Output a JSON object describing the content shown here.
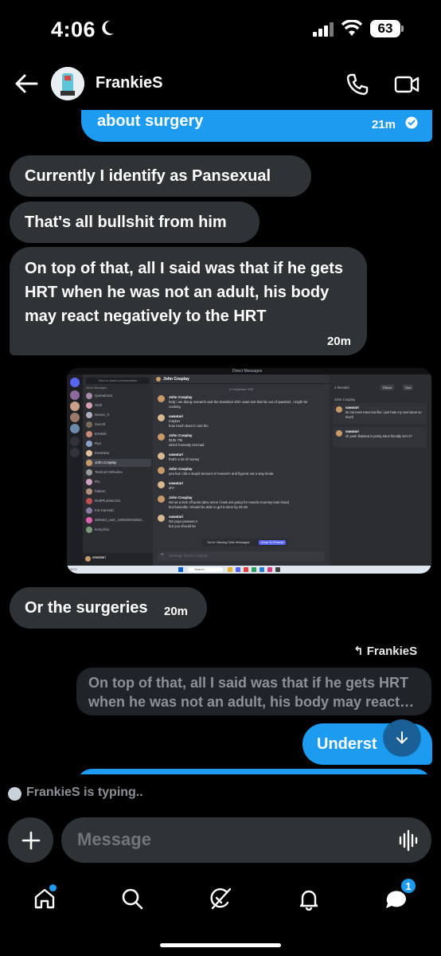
{
  "status_bar": {
    "time": "4:06",
    "battery": "63"
  },
  "header": {
    "contact_name": "FrankieS"
  },
  "messages": [
    {
      "dir": "out",
      "text": "about surgery",
      "time": "21m"
    },
    {
      "dir": "in",
      "text": "Currently I identify as Pansexual"
    },
    {
      "dir": "in",
      "text": "That's all bullshit from him"
    },
    {
      "dir": "in",
      "text": "On top of that, all I said was that if he gets HRT when he was not an adult, his body may react negatively to the HRT",
      "time": "20m"
    },
    {
      "dir": "in",
      "text": "Or the surgeries",
      "time": "20m"
    }
  ],
  "reply": {
    "label": "FrankieS",
    "quoted_text": "On top of that, all I said was that if he gets HRT when he was not an adult, his body may react…",
    "message_text": "Underst"
  },
  "typing": "FrankieS is typing..",
  "composer": {
    "placeholder": "Message"
  },
  "nav": {
    "messages_badge": "1"
  },
  "embedded_screenshot": {
    "window_title": "Direct Messages",
    "find_placeholder": "Find or start a conversation",
    "dm_section_label": "Direct Messages",
    "dm_list": [
      "Quinatoras",
      "SOZ",
      "Nexus_X",
      "Gecotl",
      "Ezekiel",
      "Ryo",
      "Kestrana",
      "John Cosplay",
      "Tactical Orthodox",
      "Ris",
      "hakam",
      "RedPlumber101",
      "Kai Kanzaki",
      "deleted_user_1665d30e5ded...",
      "kong biui"
    ],
    "current_user": "sawatari",
    "chat_name": "John Cosplay",
    "date_divider": "10 September 2025",
    "chat_messages": [
      {
        "author": "John Cosplay",
        "lines": [
          "help i am doing research and the transition shit i want isnt that far out of question, i might be",
          "cooking"
        ]
      },
      {
        "author": "sawatari",
        "lines": [
          "maybe!",
          "how much does it cost tho"
        ]
      },
      {
        "author": "John Cosplay",
        "lines": [
          "$10k  70k",
          "which honestly isnt bad"
        ]
      },
      {
        "author": "sawatari",
        "lines": [
          "that's a lot of money"
        ]
      },
      {
        "author": "John Cosplay",
        "lines": [
          "yea but i did a stupid amount of research and figured out a way kinda"
        ]
      },
      {
        "author": "sawatari",
        "lines": [
          "oh?"
        ]
      },
      {
        "author": "John Cosplay",
        "lines": [
          "NS as a kick off point (also since i lowk am going for muscle mommy look lmao)",
          "but basically i should be able to get it done by 25-25"
        ]
      },
      {
        "author": "sawatari",
        "lines": [
          "NS pays peanuts n",
          "but you should be"
        ]
      }
    ],
    "viewing_older": "You're Viewing Older Messages",
    "jump_present": "Jump To Present",
    "input_placeholder": "Message @John Cosplay",
    "search_query": "trans",
    "results_header": "2 Results",
    "filters_label": "Filters",
    "sort_label": "Sort",
    "results_channel": "John Cosplay",
    "results": [
      {
        "author": "sawatari",
        "text": "im not even trans but like i just hate my real name so much"
      },
      {
        "author": "sawatari",
        "text": "oh yeah thailand is pretty trans friendly isn't it?"
      }
    ],
    "taskbar_search": "Search",
    "weather": "31°C"
  },
  "colors": {
    "accent": "#1d9bf0",
    "bubble_in": "#2f3336",
    "background": "#000000"
  }
}
